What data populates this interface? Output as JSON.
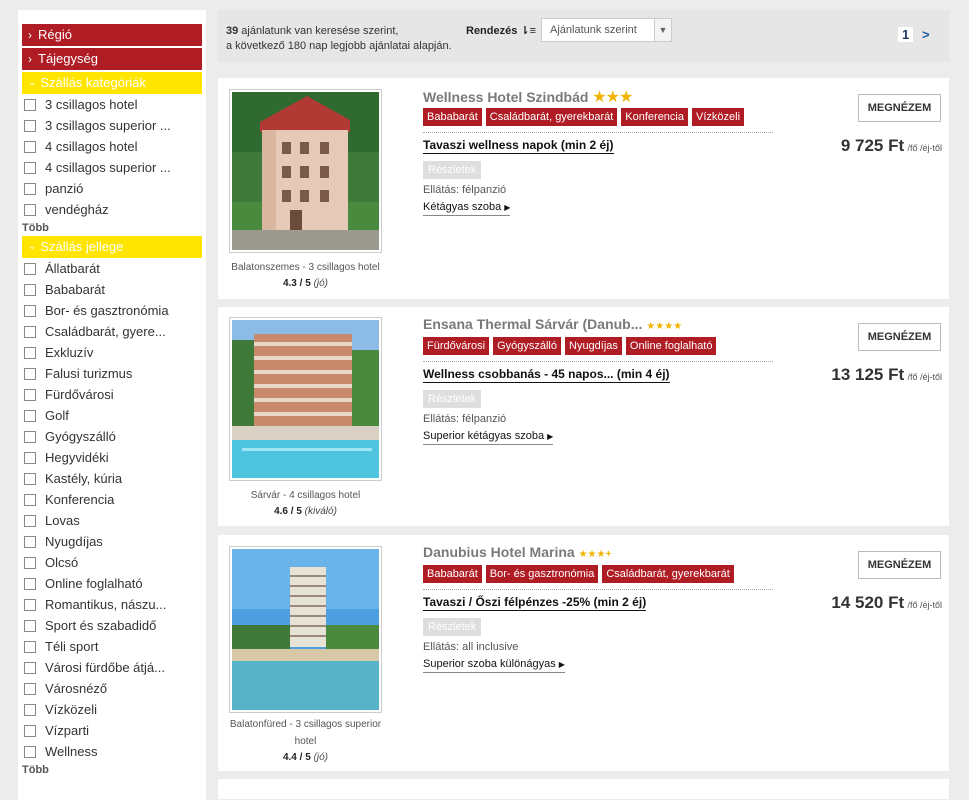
{
  "sidebar": {
    "region_label": "Régió",
    "theme_label": "Tájegység",
    "category_header": "Szállás kategóriák",
    "categories": [
      "3 csillagos hotel",
      "3 csillagos superior ...",
      "4 csillagos hotel",
      "4 csillagos superior ...",
      "panzió",
      "vendégház"
    ],
    "more1": "Több",
    "type_header": "Szállás jellege",
    "types": [
      "Állatbarát",
      "Bababarát",
      "Bor- és gasztronómia",
      "Családbarát, gyere...",
      "Exkluzív",
      "Falusi turizmus",
      "Fürdővárosi",
      "Golf",
      "Gyógyszálló",
      "Hegyvidéki",
      "Kastély, kúria",
      "Konferencia",
      "Lovas",
      "Nyugdíjas",
      "Olcsó",
      "Online foglalható",
      "Romantikus, nászu...",
      "Sport és szabadidő",
      "Téli sport",
      "Városi fürdőbe átjá...",
      "Városnéző",
      "Vízközeli",
      "Vízparti",
      "Wellness"
    ],
    "more2": "Több"
  },
  "topbar": {
    "count": "39",
    "result_line1": " ajánlatunk van keresése szerint,",
    "result_line2": "a következő 180 nap legjobb ajánlatai alapján.",
    "sort_label": "Rendezés",
    "sort_icon": "sort-desc-icon",
    "sort_value": "Ajánlatunk szerint",
    "current_page": "1",
    "next_page": ">"
  },
  "hotels": [
    {
      "name": "Wellness Hotel Szindbád",
      "stars": "★★★",
      "tags": [
        "Bababarát",
        "Családbarát, gyerekbarát",
        "Konferencia",
        "Vízközeli"
      ],
      "offer": "Tavaszi wellness napok (min 2 éj)",
      "details": "Részletek",
      "board": "Ellátás: félpanzió",
      "room": "Kétágyas szoba",
      "see": "MEGNÉZEM",
      "price": "9 725 Ft",
      "unit": "/fő /éj-től",
      "caption": "Balatonszemes - 3 csillagos hotel",
      "rating": "4.3 / 5",
      "rating_word": "(jó)"
    },
    {
      "name": "Ensana Thermal Sárvár (Danub...",
      "stars": "★★★★",
      "tags": [
        "Fürdővárosi",
        "Gyógyszálló",
        "Nyugdíjas",
        "Online foglalható"
      ],
      "offer": "Wellness csobbanás - 45 napos... (min 4 éj)",
      "details": "Részletek",
      "board": "Ellátás: félpanzió",
      "room": "Superior kétágyas szoba",
      "see": "MEGNÉZEM",
      "price": "13 125 Ft",
      "unit": "/fő /éj-től",
      "caption": "Sárvár - 4 csillagos hotel",
      "rating": "4.6 / 5",
      "rating_word": "(kiváló)"
    },
    {
      "name": "Danubius Hotel Marina",
      "stars": "★★★+",
      "tags": [
        "Bababarát",
        "Bor- és gasztronómia",
        "Családbarát, gyerekbarát"
      ],
      "offer": "Tavaszi / Őszi félpénzes -25% (min 2 éj)",
      "details": "Részletek",
      "board": "Ellátás: all inclusive",
      "room": "Superior szoba különágyas",
      "see": "MEGNÉZEM",
      "price": "14 520 Ft",
      "unit": "/fő /éj-től",
      "caption": "Balatonfüred - 3 csillagos superior hotel",
      "rating": "4.4 / 5",
      "rating_word": "(jó)"
    }
  ],
  "colors": {
    "accent_red": "#b01c24",
    "section_yellow": "#ffe500",
    "star": "#f0b400"
  }
}
